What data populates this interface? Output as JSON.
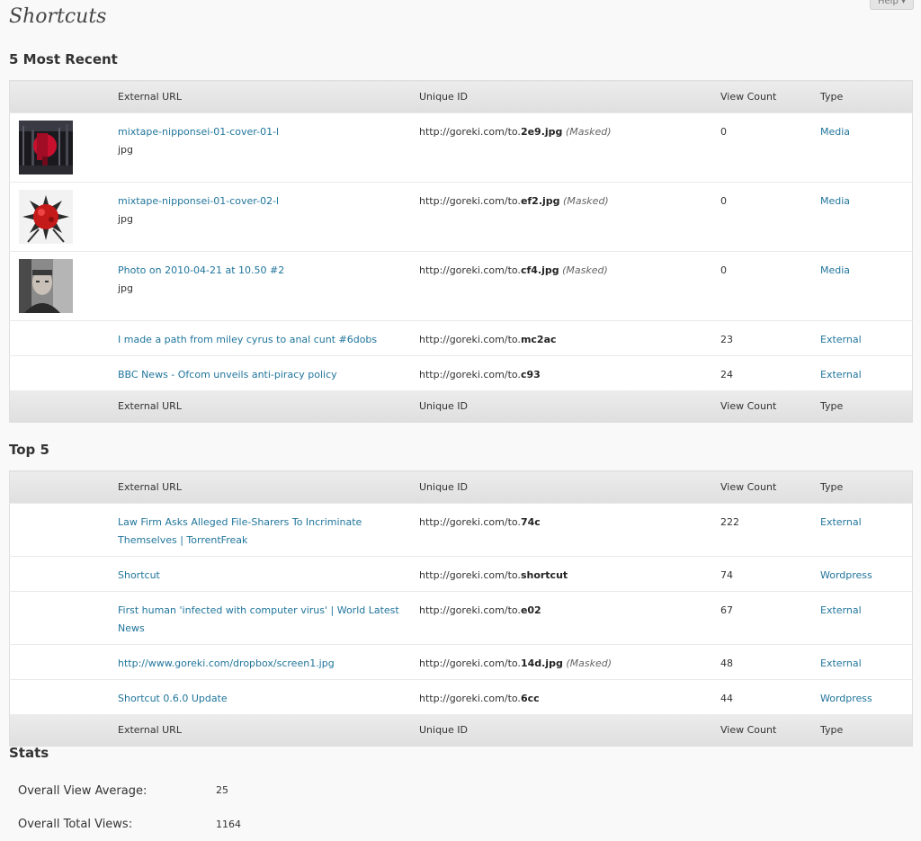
{
  "header": {
    "title": "Shortcuts",
    "help_label": "Help ▾"
  },
  "columns": {
    "thumb": "",
    "url": "External URL",
    "uid": "Unique ID",
    "count": "View Count",
    "type": "Type"
  },
  "recent": {
    "title": "5 Most Recent",
    "rows": [
      {
        "name": "mixtape-nipponsei-01-cover-01-l",
        "ext": "jpg",
        "uid_prefix": "http://goreki.com/to.",
        "uid_code": "2e9.jpg",
        "masked": "(Masked)",
        "count": "0",
        "type": "Media",
        "thumb": "red-figure-thumbnail"
      },
      {
        "name": "mixtape-nipponsei-01-cover-02-l",
        "ext": "jpg",
        "uid_prefix": "http://goreki.com/to.",
        "uid_code": "ef2.jpg",
        "masked": "(Masked)",
        "count": "0",
        "type": "Media",
        "thumb": "red-splash-thumbnail"
      },
      {
        "name": "Photo on 2010-04-21 at 10.50 #2",
        "ext": "jpg",
        "uid_prefix": "http://goreki.com/to.",
        "uid_code": "cf4.jpg",
        "masked": "(Masked)",
        "count": "0",
        "type": "Media",
        "thumb": "portrait-thumbnail"
      },
      {
        "name": "I made a path from miley cyrus to anal cunt #6dobs",
        "ext": "",
        "uid_prefix": "http://goreki.com/to.",
        "uid_code": "mc2ac",
        "masked": "",
        "count": "23",
        "type": "External",
        "thumb": ""
      },
      {
        "name": "BBC News - Ofcom unveils anti-piracy policy",
        "ext": "",
        "uid_prefix": "http://goreki.com/to.",
        "uid_code": "c93",
        "masked": "",
        "count": "24",
        "type": "External",
        "thumb": ""
      }
    ]
  },
  "top": {
    "title": "Top 5",
    "rows": [
      {
        "name": "Law Firm Asks Alleged File-Sharers To Incriminate Themselves | TorrentFreak",
        "uid_prefix": "http://goreki.com/to.",
        "uid_code": "74c",
        "masked": "",
        "count": "222",
        "type": "External"
      },
      {
        "name": "Shortcut",
        "uid_prefix": "http://goreki.com/to.",
        "uid_code": "shortcut",
        "masked": "",
        "count": "74",
        "type": "Wordpress"
      },
      {
        "name": "First human 'infected with computer virus' | World Latest News",
        "uid_prefix": "http://goreki.com/to.",
        "uid_code": "e02",
        "masked": "",
        "count": "67",
        "type": "External"
      },
      {
        "name": "http://www.goreki.com/dropbox/screen1.jpg",
        "uid_prefix": "http://goreki.com/to.",
        "uid_code": "14d.jpg",
        "masked": "(Masked)",
        "count": "48",
        "type": "External"
      },
      {
        "name": "Shortcut 0.6.0 Update",
        "uid_prefix": "http://goreki.com/to.",
        "uid_code": "6cc",
        "masked": "",
        "count": "44",
        "type": "Wordpress"
      }
    ]
  },
  "stats": {
    "title": "Stats",
    "average_label": "Overall View Average:",
    "average_value": "25",
    "total_label": "Overall Total Views:",
    "total_value": "1164"
  }
}
